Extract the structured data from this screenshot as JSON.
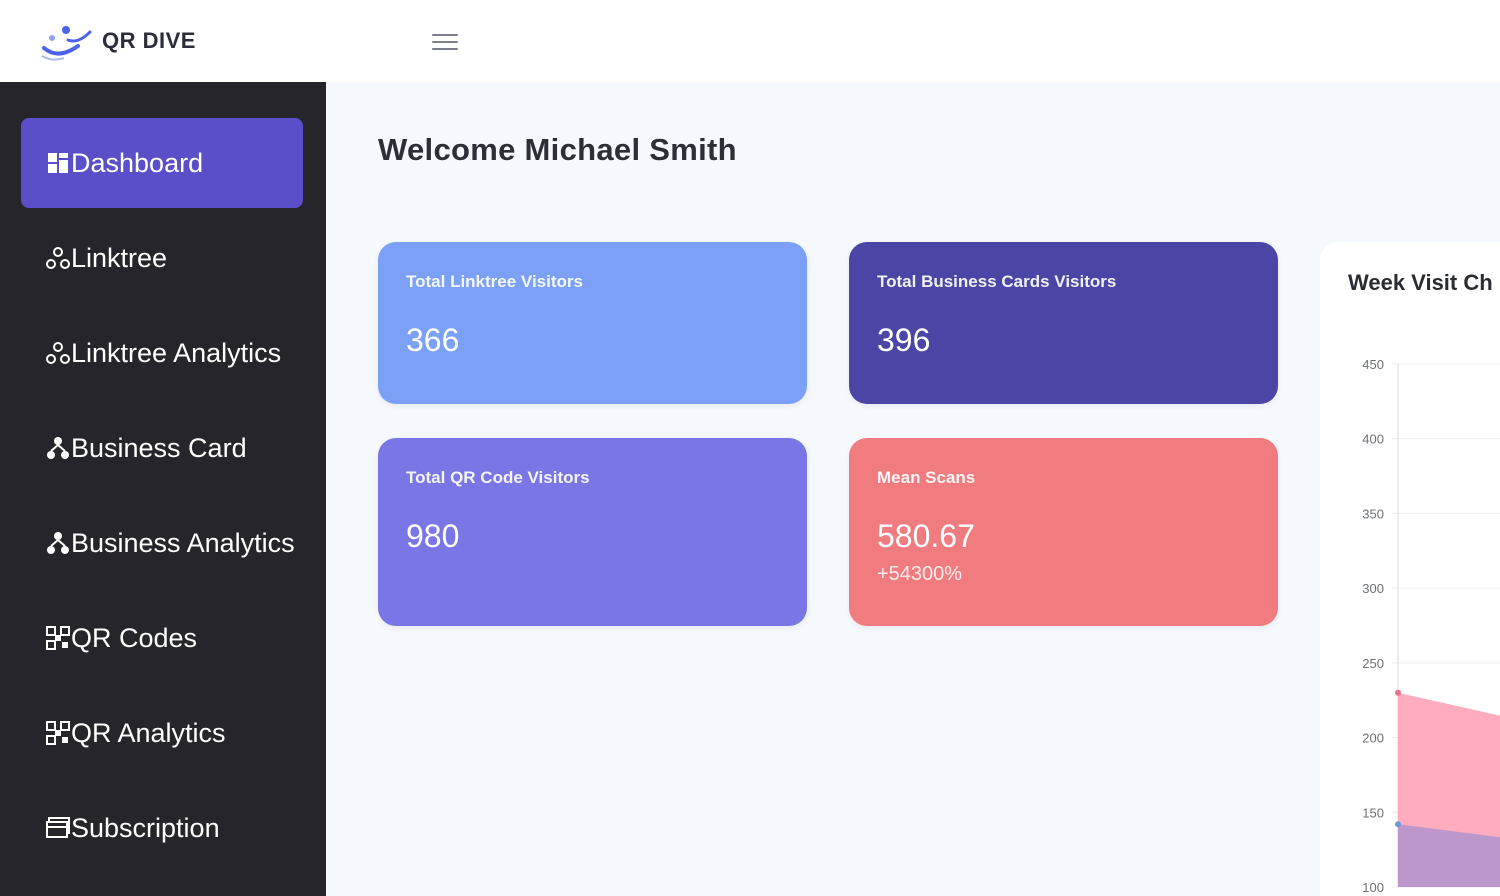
{
  "app": {
    "logo_text": "QR DIVE"
  },
  "sidebar": {
    "items": [
      {
        "label": "Dashboard",
        "icon": "dashboard-icon",
        "active": true
      },
      {
        "label": "Linktree",
        "icon": "linktree-icon",
        "active": false
      },
      {
        "label": "Linktree Analytics",
        "icon": "linktree-icon",
        "active": false
      },
      {
        "label": "Business Card",
        "icon": "business-icon",
        "active": false
      },
      {
        "label": "Business Analytics",
        "icon": "business-icon",
        "active": false
      },
      {
        "label": "QR Codes",
        "icon": "qr-icon",
        "active": false
      },
      {
        "label": "QR Analytics",
        "icon": "qr-icon",
        "active": false
      },
      {
        "label": "Subscription",
        "icon": "subscription-icon",
        "active": false
      }
    ]
  },
  "main": {
    "welcome": "Welcome Michael Smith",
    "cards": [
      {
        "label": "Total Linktree Visitors",
        "value": "366"
      },
      {
        "label": "Total Business Cards Visitors",
        "value": "396"
      },
      {
        "label": "Total QR Code Visitors",
        "value": "980"
      },
      {
        "label": "Mean Scans",
        "value": "580.67",
        "delta": "+54300%"
      }
    ]
  },
  "colors": {
    "accent": "#5a4fc8",
    "sidebar_bg": "#26252b",
    "card_linktree": "#7ba0f6",
    "card_business": "#4b46a5",
    "card_qr": "#7a76e6",
    "card_mean": "#f07c80",
    "series_pink": "#ff9fb3",
    "series_purple": "#a690cf"
  },
  "chart_data": {
    "type": "area",
    "title": "Week Visit Ch",
    "yticks": [
      "450",
      "400",
      "350",
      "300",
      "250",
      "200",
      "150",
      "100"
    ],
    "ylim": [
      100,
      450
    ],
    "grid": true,
    "series": [
      {
        "values": [
          230,
          200
        ]
      },
      {
        "values": [
          142,
          125
        ]
      }
    ]
  }
}
